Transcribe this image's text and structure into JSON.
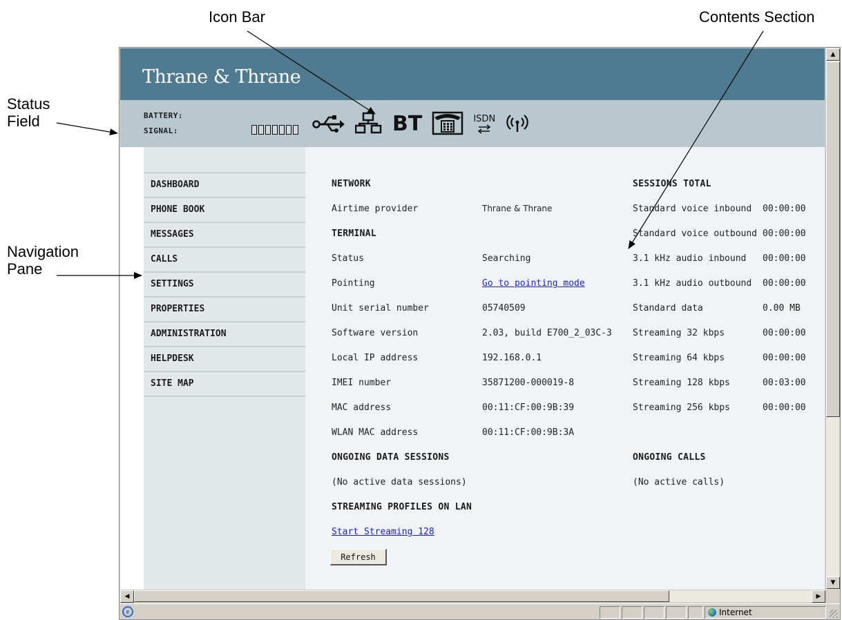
{
  "callouts": {
    "icon_bar": "Icon Bar",
    "contents_section": "Contents Section",
    "status_field_line1": "Status",
    "status_field_line2": "Field",
    "navigation_pane_line1": "Navigation",
    "navigation_pane_line2": "Pane"
  },
  "header": {
    "brand": "Thrane & Thrane",
    "battery_label": "BATTERY:",
    "signal_label": "SIGNAL:",
    "signal_bars_lit": 0,
    "signal_bars_total": 7,
    "header_color": "#4f7b90",
    "statusbar_color": "#b8c8ce"
  },
  "icon_bar": {
    "icons": [
      "usb-icon",
      "lan-icon",
      "bluetooth-icon",
      "phone-icon",
      "isdn-icon",
      "wlan-icon"
    ],
    "bt_text": "BT",
    "isdn_text": "ISDN"
  },
  "nav": {
    "items": [
      "DASHBOARD",
      "PHONE BOOK",
      "MESSAGES",
      "CALLS",
      "SETTINGS",
      "PROPERTIES",
      "ADMINISTRATION",
      "HELPDESK",
      "SITE MAP"
    ]
  },
  "content": {
    "network": {
      "heading": "NETWORK",
      "airtime_label": "Airtime provider",
      "airtime_value": "Thrane & Thrane"
    },
    "terminal": {
      "heading": "TERMINAL",
      "rows": [
        {
          "label": "Status",
          "value": "Searching"
        },
        {
          "label": "Pointing",
          "value": "Go to pointing mode"
        },
        {
          "label": "Unit serial number",
          "value": "05740509"
        },
        {
          "label": "Software version",
          "value": "2.03, build E700_2_03C-3"
        },
        {
          "label": "Local IP address",
          "value": "192.168.0.1"
        },
        {
          "label": "IMEI number",
          "value": "35871200-000019-8"
        },
        {
          "label": "MAC address",
          "value": "00:11:CF:00:9B:39"
        },
        {
          "label": "WLAN MAC address",
          "value": "00:11:CF:00:9B:3A"
        }
      ]
    },
    "sessions": {
      "heading": "SESSIONS TOTAL",
      "rows": [
        {
          "label": "Standard voice inbound",
          "value": "00:00:00"
        },
        {
          "label": "Standard voice outbound",
          "value": "00:00:00"
        },
        {
          "label": "3.1 kHz audio inbound",
          "value": "00:00:00"
        },
        {
          "label": "3.1 kHz audio outbound",
          "value": "00:00:00"
        },
        {
          "label": "Standard data",
          "value": "0.00 MB"
        },
        {
          "label": "Streaming 32 kbps",
          "value": "00:00:00"
        },
        {
          "label": "Streaming 64 kbps",
          "value": "00:00:00"
        },
        {
          "label": "Streaming 128 kbps",
          "value": "00:03:00"
        },
        {
          "label": "Streaming 256 kbps",
          "value": "00:00:00"
        }
      ]
    },
    "ongoing_data": {
      "heading": "ONGOING DATA SESSIONS",
      "text": "(No active data sessions)"
    },
    "ongoing_calls": {
      "heading": "ONGOING CALLS",
      "text": "(No active calls)"
    },
    "streaming": {
      "heading": "STREAMING PROFILES ON LAN",
      "link": "Start Streaming 128"
    },
    "refresh_label": "Refresh",
    "link_color": "#1a1fd6"
  },
  "browser": {
    "zone": "Internet",
    "icon": "ie-icon"
  }
}
